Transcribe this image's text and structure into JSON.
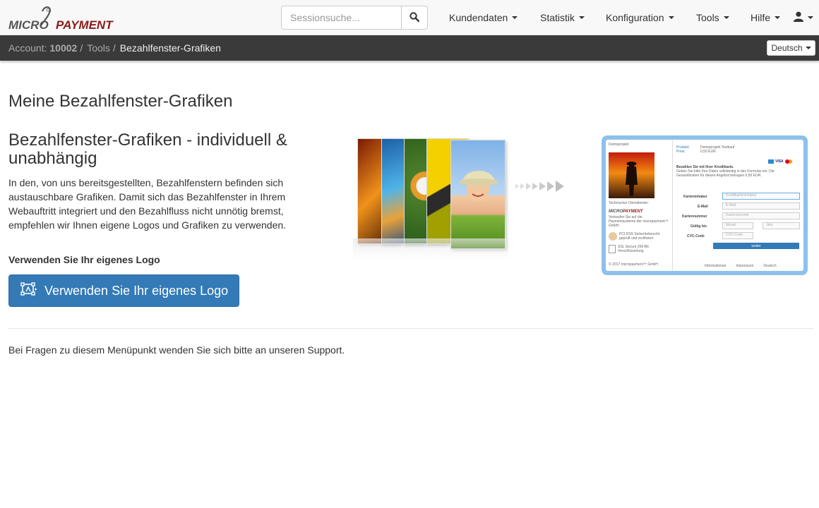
{
  "app": {
    "logo_text_1": "MICRO",
    "logo_text_2": "PAYMENT",
    "brand_color": "#8b1b1b"
  },
  "navbar": {
    "search_placeholder": "Sessionsuche...",
    "search_icon": "search-icon",
    "menus": [
      {
        "label": "Kundendaten"
      },
      {
        "label": "Statistik"
      },
      {
        "label": "Konfiguration"
      },
      {
        "label": "Tools"
      },
      {
        "label": "Hilfe"
      }
    ],
    "user_icon": "user-icon"
  },
  "breadcrumb": {
    "account_label": "Account:",
    "account_id": "10002",
    "tools": "Tools",
    "current": "Bezahlfenster-Grafiken"
  },
  "language": {
    "selected": "Deutsch"
  },
  "main": {
    "page_title": "Meine Bezahlfenster-Grafiken",
    "section_title": "Bezahlfenster-Grafiken - individuell & unabhängig",
    "description": "In den, von uns bereitsgestellten, Bezahlfenstern befinden sich austauschbare Grafiken. Damit sich das Bezahlfenster in Ihrem Webauftritt integriert und den Bezahlfluss nicht unnötig bremst, empfehlen wir Ihnen eigene Logos und Grafiken zu verwenden.",
    "sub_heading": "Verwenden Sie Ihr eigenes Logo",
    "button_label": "Verwenden Sie Ihr eigenes Logo",
    "footer_note": "Bei Fragen zu diesem Menüpunkt wenden Sie sich bitte an unseren Support."
  },
  "preview": {
    "project_label": "Demoprojekt",
    "product_label": "Produkt:",
    "product_value": "Demoprojekt Testkauf",
    "price_label": "Preis:",
    "price_value": "0,50 EUR",
    "pay_heading": "Bezahlen Sie mit Ihrer Kreditkarte.",
    "pay_text": "Geben Sie bitte Ihre Daten vollständig in das Formular ein. Die Gesamtkosten für dieses Angebot betragen 0,50 EUR.",
    "fields": [
      {
        "label": "Karteninhaber",
        "placeholder": "Kreditkarteninhaber"
      },
      {
        "label": "E-Mail",
        "placeholder": "E-Mail"
      },
      {
        "label": "Kartennummer",
        "placeholder": "Kartennummer"
      },
      {
        "label": "Gültig bis",
        "placeholder": "Monat"
      },
      {
        "label": "CVC-Code",
        "placeholder": "CVC-Code"
      }
    ],
    "year_placeholder": "Jahr",
    "submit": "weiter",
    "support_label": "Technischer Dienstleister:",
    "micro_text": "Verkaufen Sie auf die Paymentsysteme der micropayment™ GmbH.",
    "pci_text": "PCI DSS Sicherheitsrecht geprüft und zertifiziert",
    "ssl_text": "SSL Secure 256-Bit Verschlüsselung",
    "copyright": "© 2017 micropayment™ GmbH",
    "footer_links": [
      "Informationen",
      "Impressum",
      "Deutsch"
    ]
  }
}
